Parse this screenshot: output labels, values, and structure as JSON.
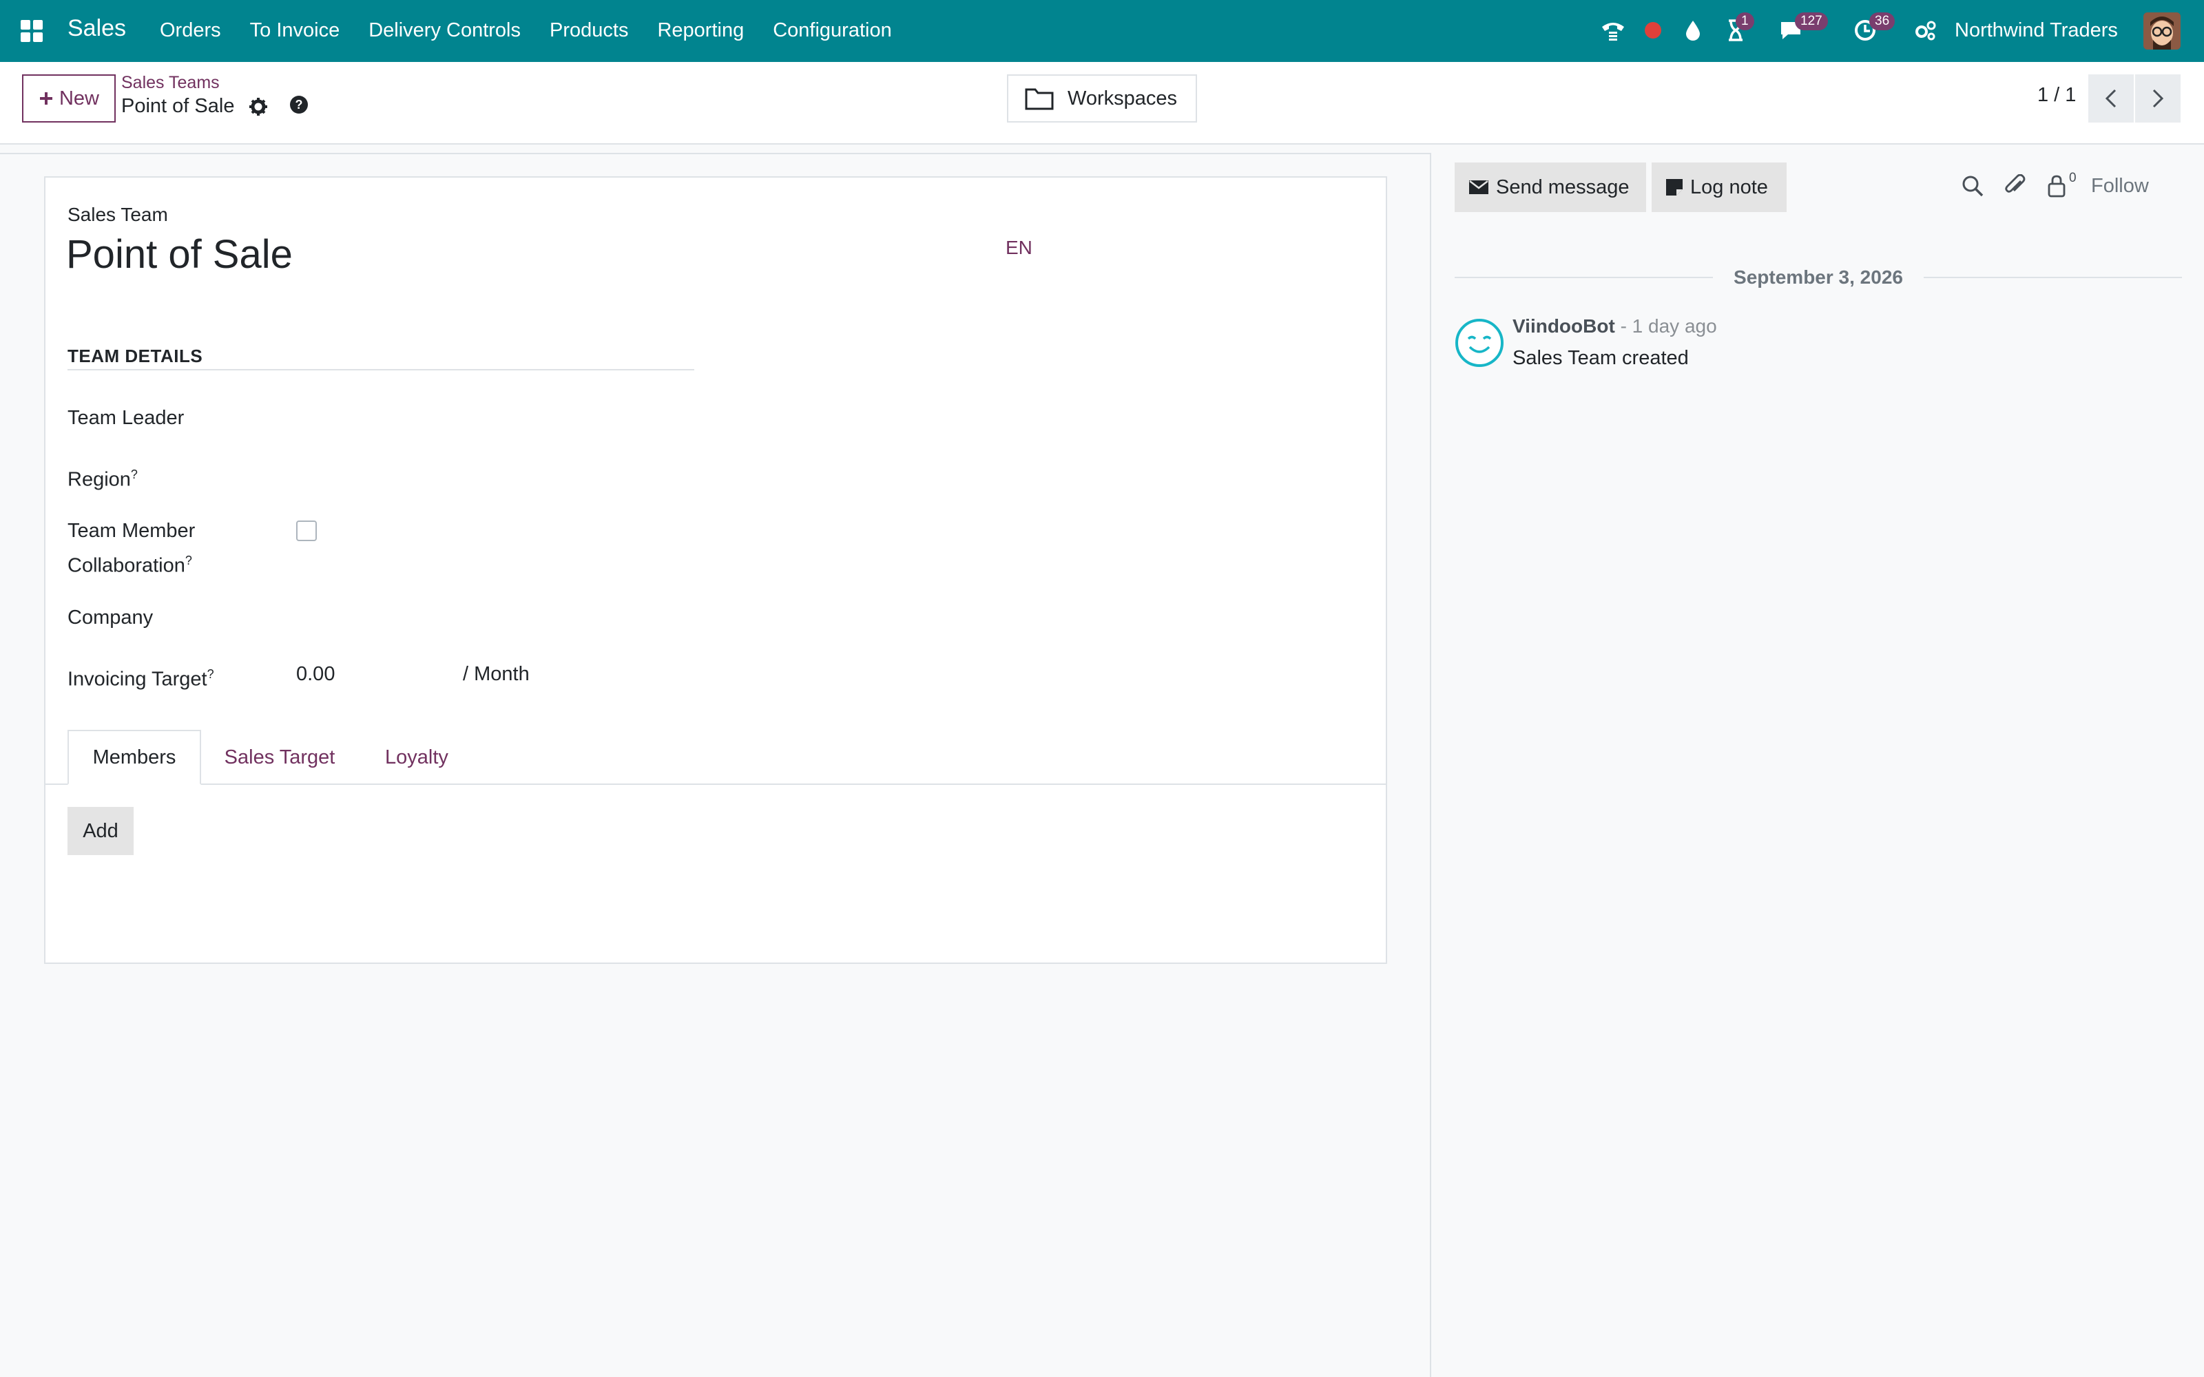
{
  "app": {
    "name": "Sales"
  },
  "menu": [
    "Orders",
    "To Invoice",
    "Delivery Controls",
    "Products",
    "Reporting",
    "Configuration"
  ],
  "systray": {
    "activity_badge": "1",
    "messages_badge": "127",
    "clock_badge": "36",
    "company": "Northwind Traders"
  },
  "control": {
    "new_label": "New",
    "breadcrumb_parent": "Sales Teams",
    "breadcrumb_current": "Point of Sale",
    "workspaces_label": "Workspaces",
    "pager": "1 / 1"
  },
  "form": {
    "record_type": "Sales Team",
    "name": "Point of Sale",
    "lang": "EN",
    "group_title": "TEAM DETAILS",
    "fields": {
      "team_leader": "Team Leader",
      "region": "Region",
      "collab_line1": "Team Member",
      "collab_line2": "Collaboration",
      "company": "Company",
      "invoicing_target": "Invoicing Target",
      "invoicing_value": "0.00",
      "invoicing_unit": "/ Month"
    },
    "help_mark": "?",
    "tabs": [
      "Members",
      "Sales Target",
      "Loyalty"
    ],
    "add_label": "Add"
  },
  "chatter": {
    "send_message": "Send message",
    "log_note": "Log note",
    "followers_count": "0",
    "follow": "Follow",
    "date": "September 3, 2026",
    "message": {
      "author": "ViindooBot",
      "time": " - 1 day ago",
      "body": "Sales Team created"
    }
  },
  "colors": {
    "navbar": "#01848f",
    "brand_accent": "#71315f",
    "badge": "#7a3e6e",
    "bot_avatar": "#17b6c7"
  }
}
